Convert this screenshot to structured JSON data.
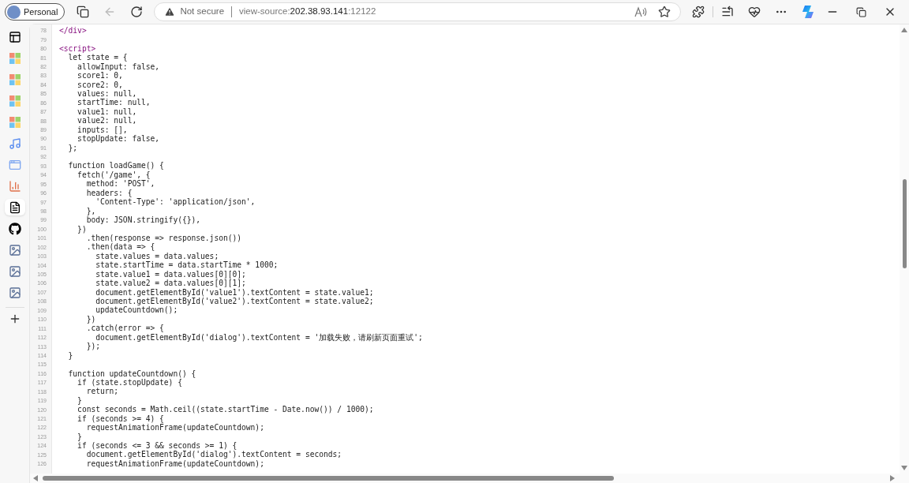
{
  "profile": {
    "label": "Personal"
  },
  "address_bar": {
    "security": "Not secure",
    "scheme": "view-source:",
    "host": "202.38.93.141",
    "port": ":12122"
  },
  "sidebar": {
    "items": [
      {
        "kind": "tabs",
        "selected": false
      },
      {
        "kind": "apps",
        "selected": false
      },
      {
        "kind": "apps",
        "selected": false
      },
      {
        "kind": "apps",
        "selected": false
      },
      {
        "kind": "apps",
        "selected": false
      },
      {
        "kind": "music",
        "selected": false
      },
      {
        "kind": "window",
        "selected": false
      },
      {
        "kind": "chart",
        "selected": false
      },
      {
        "kind": "document",
        "selected": true
      },
      {
        "kind": "github",
        "selected": false
      },
      {
        "kind": "image",
        "selected": false
      },
      {
        "kind": "image",
        "selected": false
      },
      {
        "kind": "image",
        "selected": false
      }
    ]
  },
  "source": {
    "lines": [
      {
        "number": "78",
        "kind": "tag",
        "text": "</div>"
      },
      {
        "number": "79"
      },
      {
        "number": "80",
        "kind": "tag",
        "text": "<script>"
      },
      {
        "number": "81",
        "kind": "code",
        "text": "  let state = {"
      },
      {
        "number": "82",
        "kind": "code",
        "text": "    allowInput: false,"
      },
      {
        "number": "83",
        "kind": "code",
        "text": "    score1: 0,"
      },
      {
        "number": "84",
        "kind": "code",
        "text": "    score2: 0,"
      },
      {
        "number": "85",
        "kind": "code",
        "text": "    values: null,"
      },
      {
        "number": "86",
        "kind": "code",
        "text": "    startTime: null,"
      },
      {
        "number": "87",
        "kind": "code",
        "text": "    value1: null,"
      },
      {
        "number": "88",
        "kind": "code",
        "text": "    value2: null,"
      },
      {
        "number": "89",
        "kind": "code",
        "text": "    inputs: [],"
      },
      {
        "number": "90",
        "kind": "code",
        "text": "    stopUpdate: false,"
      },
      {
        "number": "91",
        "kind": "code",
        "text": "  };"
      },
      {
        "number": "92"
      },
      {
        "number": "93",
        "kind": "code",
        "text": "  function loadGame() {"
      },
      {
        "number": "94",
        "kind": "code",
        "text": "    fetch('/game', {"
      },
      {
        "number": "95",
        "kind": "code",
        "text": "      method: 'POST',"
      },
      {
        "number": "96",
        "kind": "code",
        "text": "      headers: {"
      },
      {
        "number": "97",
        "kind": "code",
        "text": "        'Content-Type': 'application/json',"
      },
      {
        "number": "98",
        "kind": "code",
        "text": "      },"
      },
      {
        "number": "99",
        "kind": "code",
        "text": "      body: JSON.stringify({}),"
      },
      {
        "number": "100",
        "kind": "code",
        "text": "    })"
      },
      {
        "number": "101",
        "kind": "code",
        "text": "      .then(response => response.json())"
      },
      {
        "number": "102",
        "kind": "code",
        "text": "      .then(data => {"
      },
      {
        "number": "103",
        "kind": "code",
        "text": "        state.values = data.values;"
      },
      {
        "number": "104",
        "kind": "code",
        "text": "        state.startTime = data.startTime * 1000;"
      },
      {
        "number": "105",
        "kind": "code",
        "text": "        state.value1 = data.values[0][0];"
      },
      {
        "number": "106",
        "kind": "code",
        "text": "        state.value2 = data.values[0][1];"
      },
      {
        "number": "107",
        "kind": "code",
        "text": "        document.getElementById('value1').textContent = state.value1;"
      },
      {
        "number": "108",
        "kind": "code",
        "text": "        document.getElementById('value2').textContent = state.value2;"
      },
      {
        "number": "109",
        "kind": "code",
        "text": "        updateCountdown();"
      },
      {
        "number": "110",
        "kind": "code",
        "text": "      })"
      },
      {
        "number": "111",
        "kind": "code",
        "text": "      .catch(error => {"
      },
      {
        "number": "112",
        "kind": "code",
        "text": "        document.getElementById('dialog').textContent = '加载失败，请刷新页面重试';"
      },
      {
        "number": "113",
        "kind": "code",
        "text": "      });"
      },
      {
        "number": "114",
        "kind": "code",
        "text": "  }"
      },
      {
        "number": "115"
      },
      {
        "number": "116",
        "kind": "code",
        "text": "  function updateCountdown() {"
      },
      {
        "number": "117",
        "kind": "code",
        "text": "    if (state.stopUpdate) {"
      },
      {
        "number": "118",
        "kind": "code",
        "text": "      return;"
      },
      {
        "number": "119",
        "kind": "code",
        "text": "    }"
      },
      {
        "number": "120",
        "kind": "code",
        "text": "    const seconds = Math.ceil((state.startTime - Date.now()) / 1000);"
      },
      {
        "number": "121",
        "kind": "code",
        "text": "    if (seconds >= 4) {"
      },
      {
        "number": "122",
        "kind": "code",
        "text": "      requestAnimationFrame(updateCountdown);"
      },
      {
        "number": "123",
        "kind": "code",
        "text": "    }"
      },
      {
        "number": "124",
        "kind": "code",
        "text": "    if (seconds <= 3 && seconds >= 1) {"
      },
      {
        "number": "125",
        "kind": "code",
        "text": "      document.getElementById('dialog').textContent = seconds;"
      },
      {
        "number": "126",
        "kind": "code",
        "text": "      requestAnimationFrame(updateCountdown);"
      }
    ]
  }
}
